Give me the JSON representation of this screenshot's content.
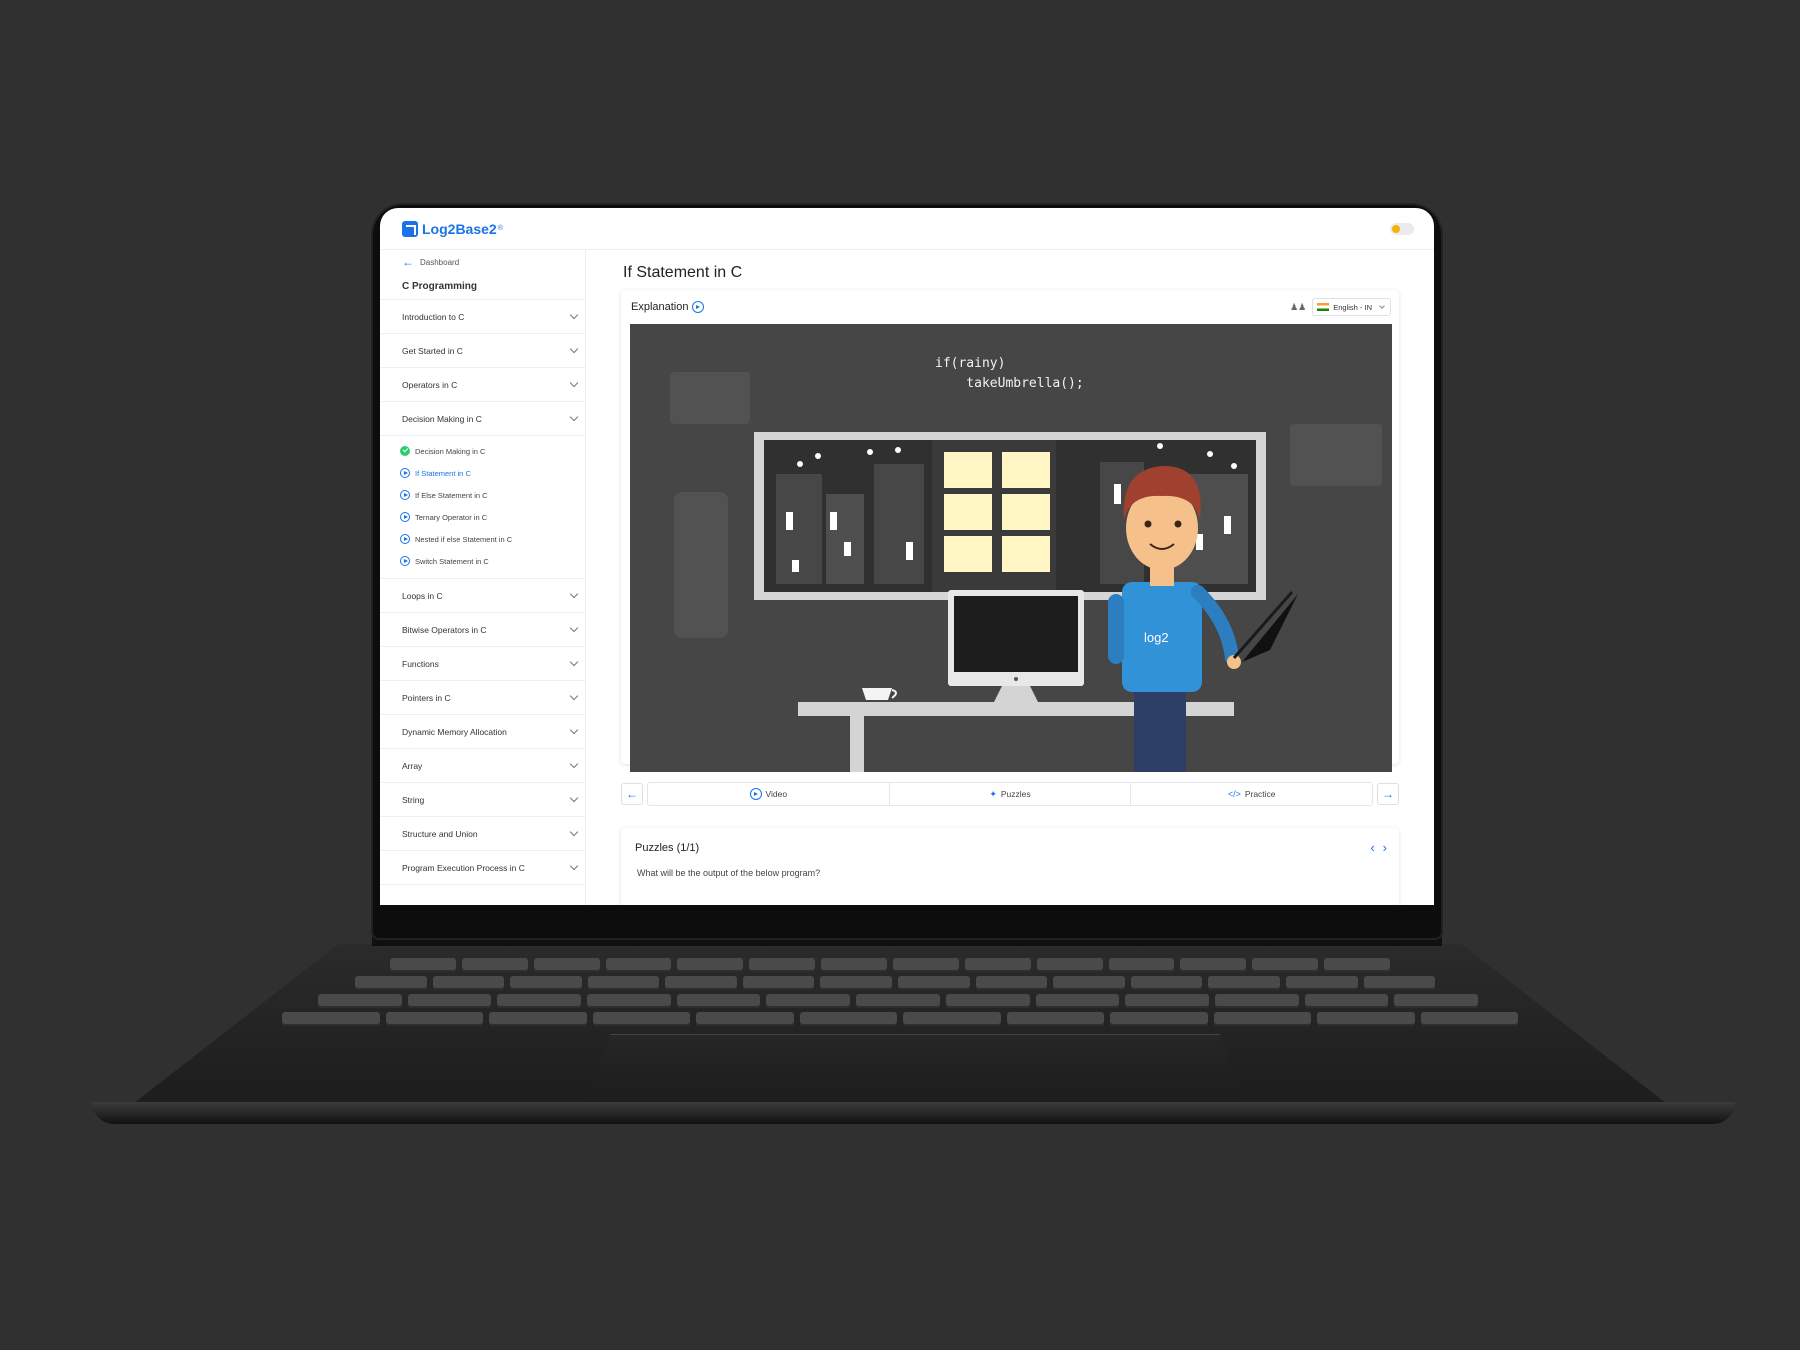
{
  "app": {
    "logo": "Log2Base2",
    "logo_reg": "®"
  },
  "sidebar": {
    "back_label": "Dashboard",
    "course_title": "C Programming",
    "sections_top": [
      {
        "label": "Introduction to C"
      },
      {
        "label": "Get Started in C"
      },
      {
        "label": "Operators in C"
      },
      {
        "label": "Decision Making in C"
      }
    ],
    "subitems": [
      {
        "label": "Decision Making in C",
        "status": "done"
      },
      {
        "label": "If Statement in C",
        "status": "active"
      },
      {
        "label": "If Else Statement in C",
        "status": "pending"
      },
      {
        "label": "Ternary Operator in C",
        "status": "pending"
      },
      {
        "label": "Nested if else Statement in C",
        "status": "pending"
      },
      {
        "label": "Switch Statement in C",
        "status": "pending"
      }
    ],
    "sections_bottom": [
      {
        "label": "Loops in C"
      },
      {
        "label": "Bitwise Operators in C"
      },
      {
        "label": "Functions"
      },
      {
        "label": "Pointers in C"
      },
      {
        "label": "Dynamic Memory Allocation"
      },
      {
        "label": "Array"
      },
      {
        "label": "String"
      },
      {
        "label": "Structure and Union"
      },
      {
        "label": "Program Execution Process in C"
      }
    ]
  },
  "main": {
    "title": "If Statement in C",
    "card": {
      "heading": "Explanation",
      "language": "English - IN",
      "code_line1": "if(rainy)",
      "code_line2": "    takeUmbrella();",
      "shirt_text": "log2"
    },
    "nav": {
      "video": "Video",
      "puzzles": "Puzzles",
      "practice": "Practice"
    },
    "puzzles": {
      "title": "Puzzles (1/1)",
      "question": "What will be the output of the below program?"
    }
  },
  "colors": {
    "accent": "#1a73e8",
    "scene_bg": "#464646",
    "window_light": "#fff6c4",
    "shirt": "#3192d8"
  }
}
